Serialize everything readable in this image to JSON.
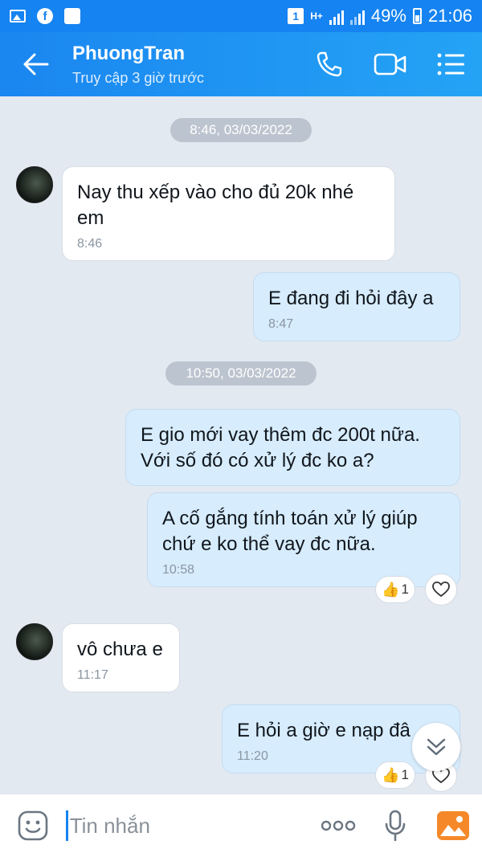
{
  "status_bar": {
    "battery": "49%",
    "time": "21:06",
    "sim_badge": "1",
    "network": "H+"
  },
  "header": {
    "contact_name": "PhuongTran",
    "presence": "Truy cập 3 giờ trước"
  },
  "messages": {
    "d1": "8:46, 03/03/2022",
    "m1": {
      "text": "Nay thu xếp vào cho đủ 20k nhé em",
      "time": "8:46"
    },
    "m2": {
      "text": "E đang đi hỏi đây a",
      "time": "8:47"
    },
    "d2": "10:50, 03/03/2022",
    "m3": {
      "text": "E gio mới vay thêm đc 200t nữa. Với số đó có xử lý đc ko a?"
    },
    "m4": {
      "text": "A cố gắng tính toán xử lý giúp chứ e ko thể vay đc nữa.",
      "time": "10:58",
      "reaction_count": "1"
    },
    "m5": {
      "text": "vô chưa e",
      "time": "11:17"
    },
    "m6": {
      "text": "E hỏi a giờ e nạp đâ",
      "time": "11:20",
      "reaction_count": "1"
    }
  },
  "input": {
    "placeholder": "Tin nhắn",
    "value": ""
  },
  "colors": {
    "header_bg": "#1a86f0",
    "chat_bg": "#e2e9f1",
    "outgoing_bubble": "#d7ecfd",
    "incoming_bubble": "#ffffff"
  },
  "icons": [
    "back-arrow-icon",
    "phone-icon",
    "video-call-icon",
    "menu-icon",
    "emoji-icon",
    "more-icon",
    "microphone-icon",
    "image-icon",
    "heart-icon",
    "thumbs-up-icon",
    "chevron-double-down-icon"
  ]
}
